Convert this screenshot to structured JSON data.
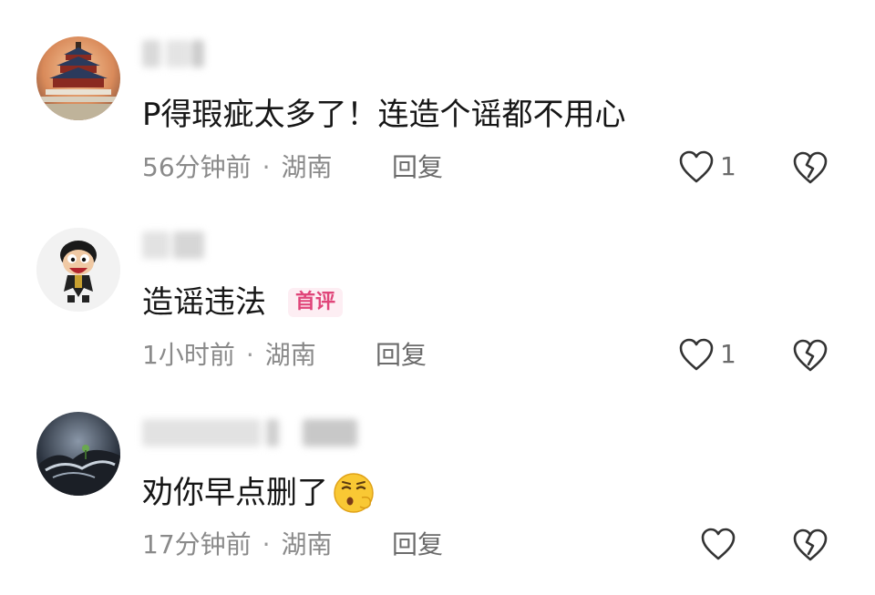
{
  "comments": [
    {
      "avatar": "temple-of-heaven-avatar",
      "text": "P得瑕疵太多了！连造个谣都不用心",
      "time": "56分钟前",
      "location": "湖南",
      "reply_label": "回复",
      "likes": "1",
      "badge": "",
      "emoji": ""
    },
    {
      "avatar": "cartoon-character-avatar",
      "text": "造谣违法",
      "time": "1小时前",
      "location": "湖南",
      "reply_label": "回复",
      "likes": "1",
      "badge": "首评",
      "emoji": ""
    },
    {
      "avatar": "night-landscape-avatar",
      "text": "劝你早点删了",
      "time": "17分钟前",
      "location": "湖南",
      "reply_label": "回复",
      "likes": "",
      "badge": "",
      "emoji": "face-blowing-kiss-emoji"
    }
  ],
  "separator": "·",
  "colors": {
    "text": "#161616",
    "meta": "#8a8a8a",
    "badge_text": "#e0467a",
    "badge_bg": "#fdeef3",
    "icon_stroke": "#333333"
  }
}
